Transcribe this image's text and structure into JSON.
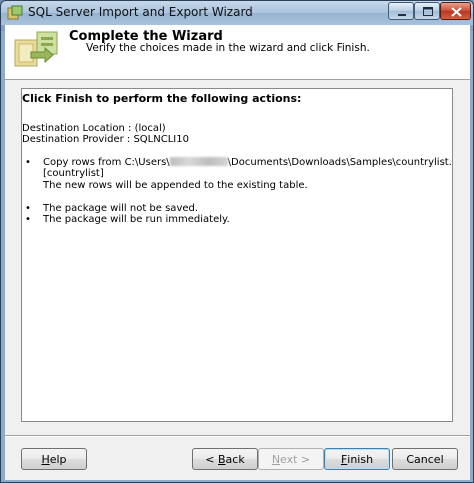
{
  "window": {
    "title": "SQL Server Import and Export Wizard",
    "icon": "wizard-app-icon",
    "controls": {
      "minimize": "minimize-icon",
      "maximize": "maximize-icon",
      "close": "close-icon"
    }
  },
  "header": {
    "title": "Complete the Wizard",
    "subtitle": "Verify the choices made in the wizard and click Finish.",
    "icon": "wizard-banner-icon"
  },
  "summary": {
    "heading": "Click Finish to perform the following actions:",
    "destination_location": "Destination Location : (local)",
    "destination_provider": "Destination Provider : SQLNCLI10",
    "bullet": "•",
    "copy_line1_prefix": "Copy rows from C:\\Users\\",
    "copy_line1_suffix": "\\Documents\\Downloads\\Samples\\countrylist.csv to [dbo].",
    "copy_line2": "[countrylist]",
    "append_note": "The new rows will be appended to the existing table.",
    "package_not_saved": "The package will not be saved.",
    "package_run": "The package will be run immediately."
  },
  "buttons": {
    "help": {
      "pre": "",
      "u": "H",
      "post": "elp"
    },
    "back": {
      "pre": "< ",
      "u": "B",
      "post": "ack"
    },
    "next": {
      "pre": "",
      "u": "N",
      "post": "ext >"
    },
    "finish": {
      "pre": "",
      "u": "F",
      "post": "inish"
    },
    "cancel": "Cancel"
  }
}
